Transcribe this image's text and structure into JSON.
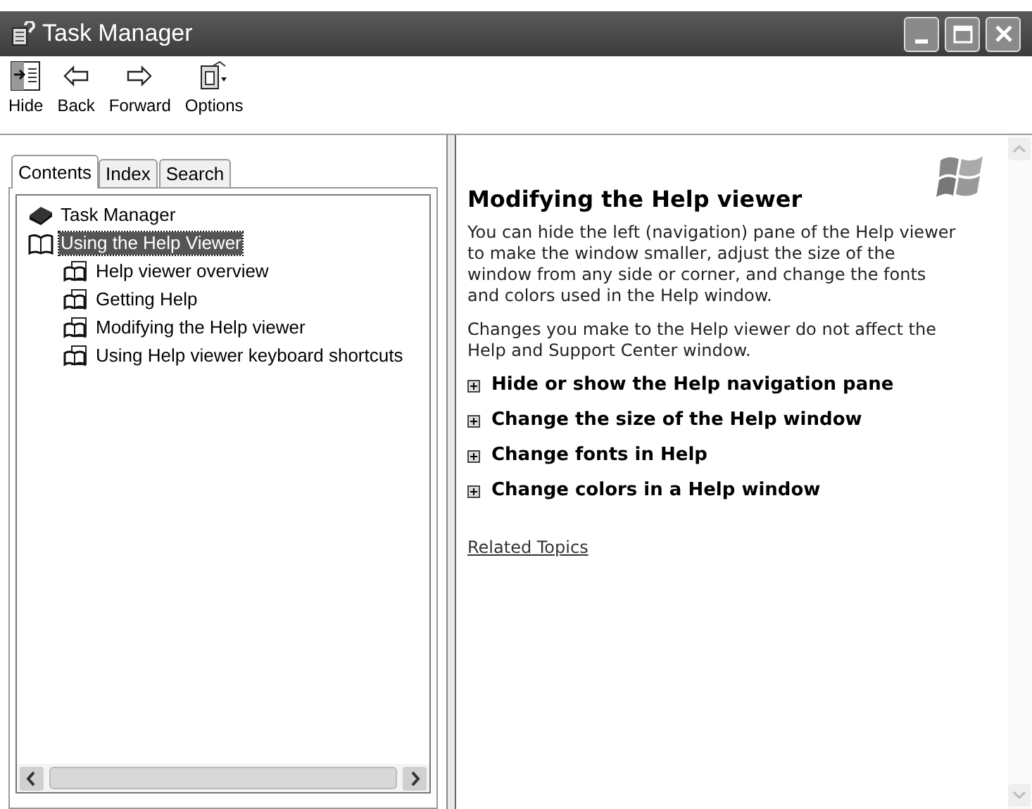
{
  "window": {
    "title": "Task Manager"
  },
  "toolbar": [
    {
      "label": "Hide",
      "kind": "hide"
    },
    {
      "label": "Back",
      "kind": "back"
    },
    {
      "label": "Forward",
      "kind": "forward"
    },
    {
      "label": "Options",
      "kind": "options"
    }
  ],
  "tabs": [
    {
      "label": "Contents",
      "selected": true
    },
    {
      "label": "Index",
      "selected": false
    },
    {
      "label": "Search",
      "selected": false
    }
  ],
  "tree": [
    {
      "label": "Task Manager",
      "kind": "book",
      "expanded": false,
      "selected": false
    },
    {
      "label": "Using the Help Viewer",
      "kind": "book",
      "expanded": true,
      "selected": true,
      "children": [
        {
          "label": "Help viewer overview",
          "kind": "page",
          "selected": false
        },
        {
          "label": "Getting Help",
          "kind": "page",
          "selected": false
        },
        {
          "label": "Modifying the Help viewer",
          "kind": "page",
          "selected": false
        },
        {
          "label": "Using Help viewer keyboard shortcuts",
          "kind": "page",
          "selected": false
        }
      ]
    }
  ],
  "article": {
    "title": "Modifying the Help viewer",
    "paragraphs": [
      "You can hide the left (navigation) pane of the Help viewer to make the window smaller, adjust the size of the window from any side or corner, and change the fonts and colors used in the Help window.",
      "Changes you make to the Help viewer do not affect the Help and Support Center window."
    ],
    "sections": [
      {
        "label": "Hide or show the Help navigation pane",
        "expanded": false
      },
      {
        "label": "Change the size of the Help window",
        "expanded": false
      },
      {
        "label": "Change fonts in Help",
        "expanded": false
      },
      {
        "label": "Change colors in a Help window",
        "expanded": false
      }
    ],
    "related_link": "Related Topics"
  }
}
